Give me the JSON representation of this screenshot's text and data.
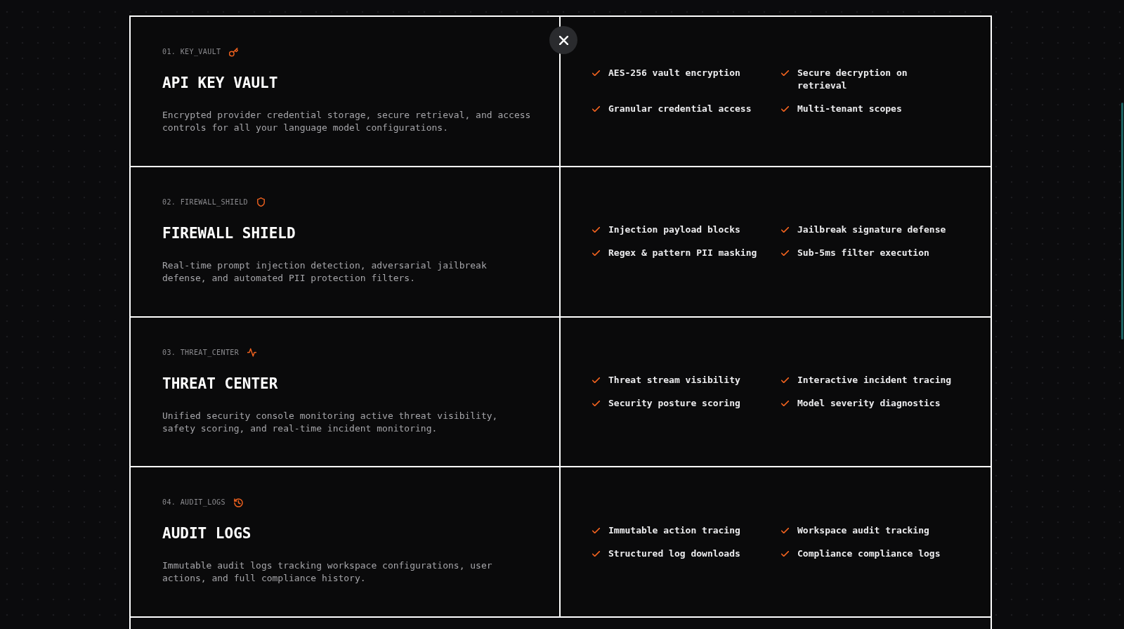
{
  "feature_cards": [
    {
      "kind": "key",
      "tag": "01. KEY_VAULT",
      "title": "API KEY VAULT",
      "description": "Encrypted provider credential storage, secure retrieval, and access controls for all your language model configurations.",
      "highlights": [
        "AES-256 vault encryption",
        "Secure decryption on retrieval",
        "Granular credential access",
        "Multi-tenant scopes"
      ]
    },
    {
      "kind": "shield",
      "tag": "02. FIREWALL_SHIELD",
      "title": "FIREWALL SHIELD",
      "description": "Real-time prompt injection detection, adversarial jailbreak defense, and automated PII protection filters.",
      "highlights": [
        "Injection payload blocks",
        "Jailbreak signature defense",
        "Regex & pattern PII masking",
        "Sub-5ms filter execution"
      ]
    },
    {
      "kind": "activity",
      "tag": "03. THREAT_CENTER",
      "title": "THREAT CENTER",
      "description": "Unified security console monitoring active threat visibility, safety scoring, and real-time incident monitoring.",
      "highlights": [
        "Threat stream visibility",
        "Interactive incident tracing",
        "Security posture scoring",
        "Model severity diagnostics"
      ]
    },
    {
      "kind": "history",
      "tag": "04. AUDIT_LOGS",
      "title": "AUDIT LOGS",
      "description": "Immutable audit logs tracking workspace configurations, user actions, and full compliance history.",
      "highlights": [
        "Immutable action tracing",
        "Workspace audit tracking",
        "Structured log downloads",
        "Compliance compliance logs"
      ]
    }
  ]
}
